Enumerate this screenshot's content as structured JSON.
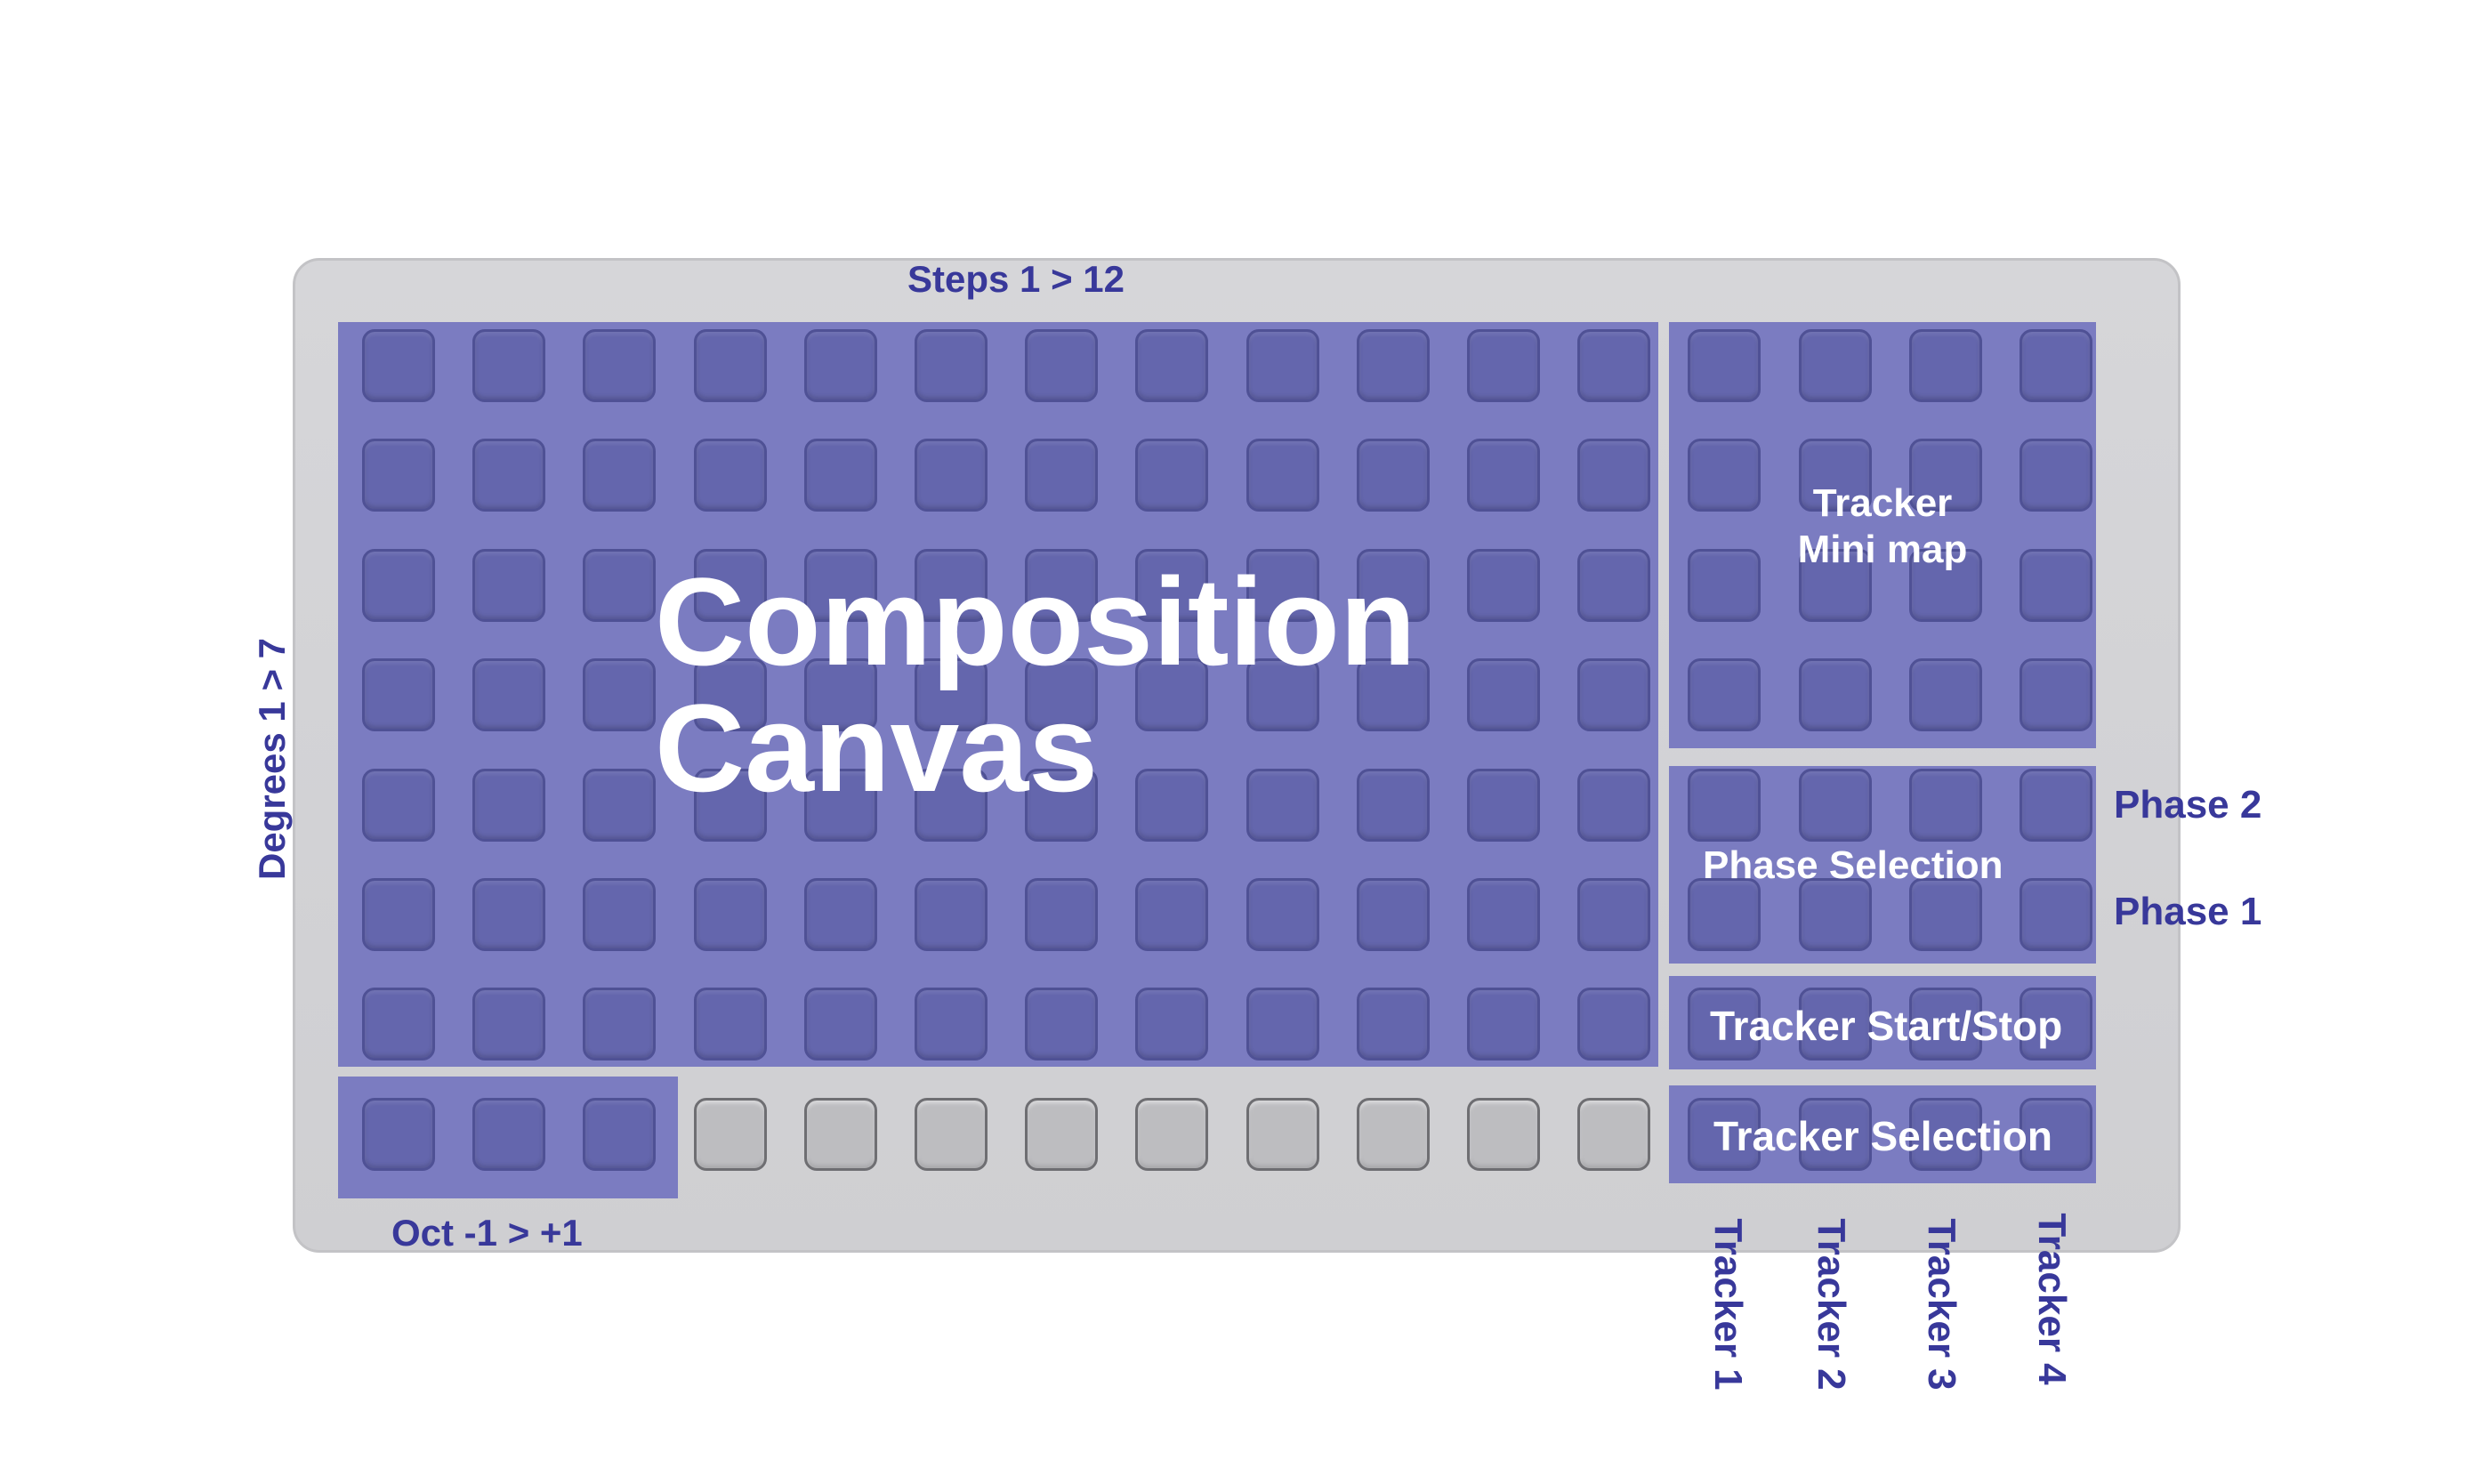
{
  "labels": {
    "steps": "Steps 1 > 12",
    "degrees": "Degrees 1 > 7",
    "oct": "Oct -1 > +1",
    "composition_line1": "Composition",
    "composition_line2": "Canvas",
    "minimap_line1": "Tracker",
    "minimap_line2": "Mini map",
    "phase_selection": "Phase Selection",
    "phase2": "Phase 2",
    "phase1": "Phase 1",
    "tracker_start_stop": "Tracker Start/Stop",
    "tracker_selection": "Tracker Selection",
    "tracker1": "Tracker 1",
    "tracker2": "Tracker 2",
    "tracker3": "Tracker 3",
    "tracker4": "Tracker 4"
  },
  "grid": {
    "columns": 16,
    "rows": 8
  },
  "colors": {
    "region_fill": "#7b7cc1",
    "pad_active": "#6466ad",
    "pad_inactive": "#bdbdc0",
    "label_text": "#38389a",
    "device_body": "#d3d3d6"
  }
}
